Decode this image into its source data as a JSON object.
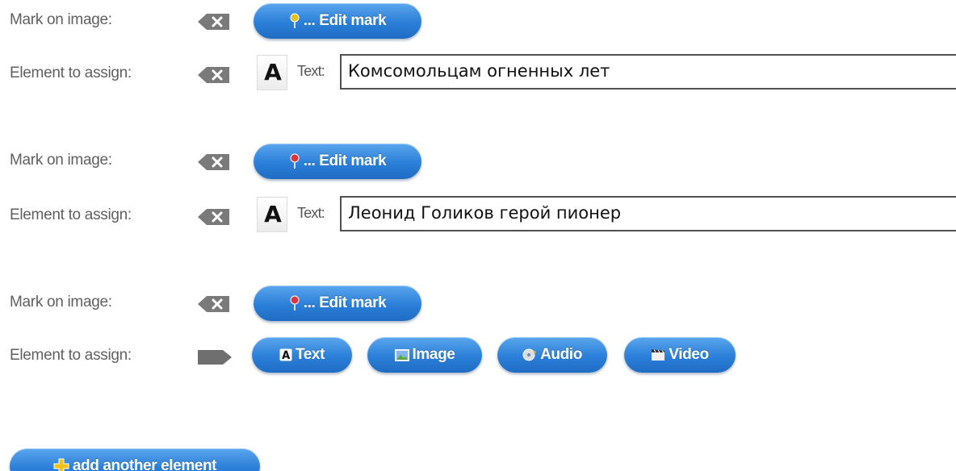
{
  "labels": {
    "mark_on_image": "Mark on image:",
    "element_to_assign": "Element to assign:"
  },
  "edit_mark_label": "... Edit mark",
  "type_text_label": "Text:",
  "items": [
    {
      "mark_pin_color": "#e8c21a",
      "text_value": "Комсомольцам огненных лет"
    },
    {
      "mark_pin_color": "#e0343a",
      "text_value": "Леонид Голиков герой пионер"
    },
    {
      "mark_pin_color": "#e0343a"
    }
  ],
  "assign_options": {
    "text": "Text",
    "image": "Image",
    "audio": "Audio",
    "video": "Video"
  },
  "add_another_label": "add another element",
  "colors": {
    "button_blue": "#2b7fd8",
    "label_gray": "#606060"
  },
  "icons": {
    "delete": "backspace-delete-icon",
    "pin": "map-pin-icon",
    "arrow": "tag-arrow-icon",
    "plus": "plus-icon"
  }
}
